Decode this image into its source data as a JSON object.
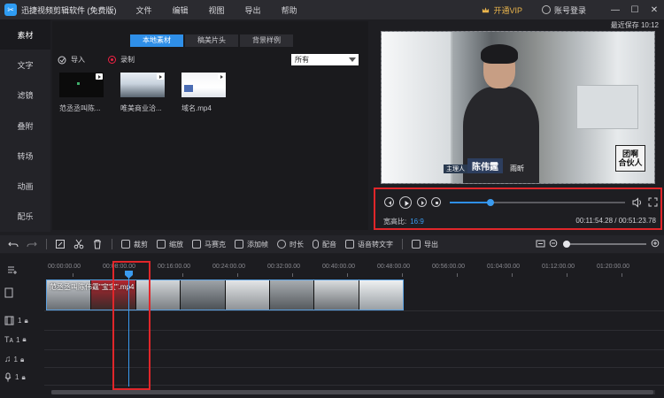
{
  "app": {
    "title": "迅捷视频剪辑软件 (免费版)",
    "menu": [
      "文件",
      "编辑",
      "视图",
      "导出",
      "帮助"
    ],
    "vip_label": "开通VIP",
    "login_label": "账号登录"
  },
  "sidebar": {
    "items": [
      {
        "label": "素材"
      },
      {
        "label": "文字"
      },
      {
        "label": "滤镜"
      },
      {
        "label": "叠附"
      },
      {
        "label": "转场"
      },
      {
        "label": "动画"
      },
      {
        "label": "配乐"
      }
    ]
  },
  "media": {
    "tabs": [
      {
        "label": "本地素材"
      },
      {
        "label": "稿美片头"
      },
      {
        "label": "背景样例"
      }
    ],
    "import_label": "导入",
    "record_label": "录制",
    "filter_value": "所有",
    "items": [
      {
        "name": "范丞丞叫陈..."
      },
      {
        "name": "唯美商业洽..."
      },
      {
        "name": "域名.mp4"
      }
    ]
  },
  "preview": {
    "last_saved": "最近保存 10:12",
    "caption_role": "主理人",
    "caption_name": "陈伟霆",
    "caption_extra": "雨昕",
    "logo_text": "团啊\n合伙人",
    "aspect_label": "宽高比:",
    "aspect_value": "16:9",
    "timecode": "00:11:54.28 / 00:51:23.78",
    "progress": 0.23
  },
  "toolbar": {
    "items": [
      {
        "label": "裁剪"
      },
      {
        "label": "缩放"
      },
      {
        "label": "马赛克"
      },
      {
        "label": "添加帧"
      },
      {
        "label": "时长"
      },
      {
        "label": "配音"
      },
      {
        "label": "语音转文字"
      },
      {
        "label": "导出"
      }
    ]
  },
  "timeline": {
    "ruler": [
      "00:00:00.00",
      "00:08:00.00",
      "00:16:00.00",
      "00:24:00.00",
      "00:32:00.00",
      "00:40:00.00",
      "00:48:00.00",
      "00:56:00.00",
      "01:04:00.00",
      "01:12:00.00",
      "01:20:00.00"
    ],
    "clip_label": "范丞丞叫陈伟霆\"宝宝\".mp4",
    "track_num": "1"
  },
  "colors": {
    "accent": "#2f8fe8",
    "highlight": "#e0262a",
    "vip": "#e9b44c"
  }
}
